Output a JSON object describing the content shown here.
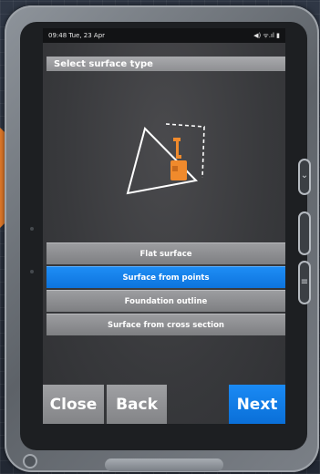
{
  "status_bar": {
    "time_date": "09:48  Tue, 23 Apr",
    "indicators": "◀) ᯤ.ıl ▮"
  },
  "header": {
    "title": "Select surface type"
  },
  "surface_options": [
    {
      "label": "Flat surface",
      "selected": false
    },
    {
      "label": "Surface from points",
      "selected": true
    },
    {
      "label": "Foundation outline",
      "selected": false
    },
    {
      "label": "Surface from cross section",
      "selected": false
    }
  ],
  "footer": {
    "close_label": "Close",
    "back_label": "Back",
    "next_label": "Next"
  },
  "colors": {
    "accent_blue": "#0d74de",
    "machine_orange": "#f08a2c",
    "button_gray": "#8e8f92"
  },
  "side_buttons": {
    "top_icon": "chevron-down-icon",
    "bottom_icon": "menu-icon"
  }
}
